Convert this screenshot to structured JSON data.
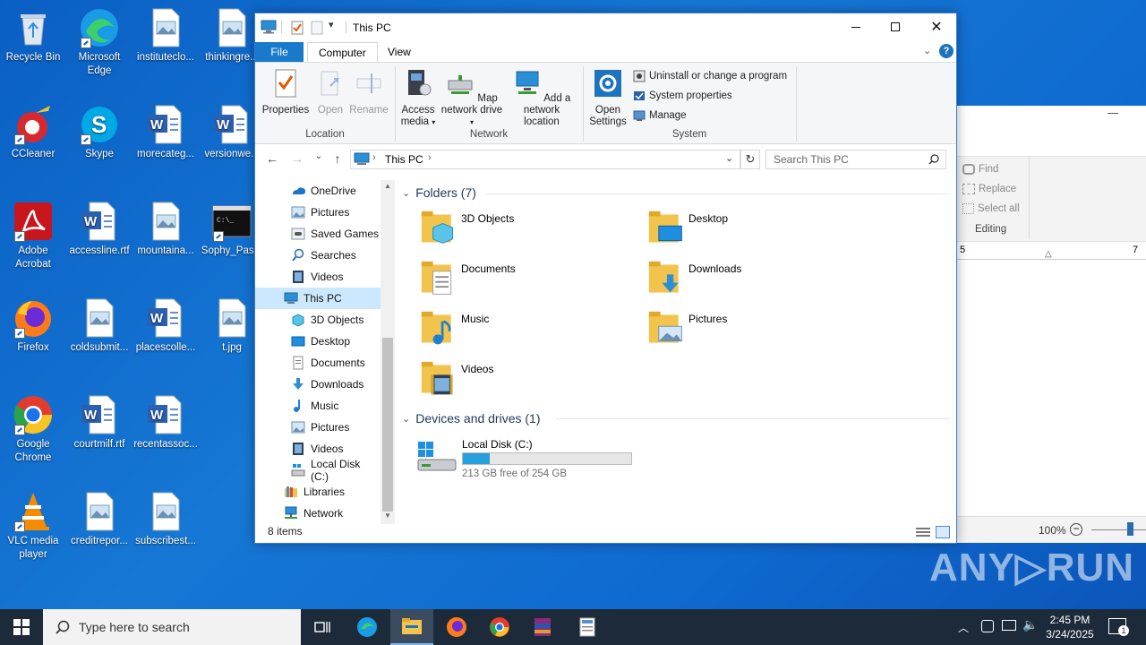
{
  "desktop": {
    "icons": [
      {
        "label": "Recycle Bin",
        "icon": "recycle-bin-icon"
      },
      {
        "label": "Microsoft Edge",
        "icon": "edge-icon"
      },
      {
        "label": "instituteclo...",
        "icon": "image-file-icon"
      },
      {
        "label": "thinkingre...",
        "icon": "image-file-icon"
      },
      {
        "label": "CCleaner",
        "icon": "ccleaner-icon"
      },
      {
        "label": "Skype",
        "icon": "skype-icon"
      },
      {
        "label": "morecateg...",
        "icon": "word-doc-icon"
      },
      {
        "label": "versionwe...",
        "icon": "word-doc-icon"
      },
      {
        "label": "Adobe Acrobat",
        "icon": "acrobat-icon"
      },
      {
        "label": "accessline.rtf",
        "icon": "word-doc-icon"
      },
      {
        "label": "mountaina...",
        "icon": "image-file-icon"
      },
      {
        "label": "Sophy_Pas...",
        "icon": "cmd-icon"
      },
      {
        "label": "Firefox",
        "icon": "firefox-icon"
      },
      {
        "label": "coldsubmit...",
        "icon": "image-file-icon"
      },
      {
        "label": "placescolle...",
        "icon": "word-doc-icon"
      },
      {
        "label": "t.jpg",
        "icon": "image-file-icon"
      },
      {
        "label": "Google Chrome",
        "icon": "chrome-icon"
      },
      {
        "label": "courtmilf.rtf",
        "icon": "word-doc-icon"
      },
      {
        "label": "recentassoc...",
        "icon": "word-doc-icon"
      },
      {
        "label": "VLC media player",
        "icon": "vlc-icon"
      },
      {
        "label": "creditrepor...",
        "icon": "image-file-icon"
      },
      {
        "label": "subscribest...",
        "icon": "image-file-icon"
      }
    ]
  },
  "word_bg": {
    "find": "Find",
    "replace": "Replace",
    "select_all": "Select all",
    "group": "Editing",
    "zoom": "100%",
    "ruler_left": "5",
    "ruler_right": "7"
  },
  "explorer": {
    "title": "This PC",
    "tabs": {
      "file": "File",
      "computer": "Computer",
      "view": "View"
    },
    "ribbon": {
      "properties": "Properties",
      "open": "Open",
      "rename": "Rename",
      "location_group": "Location",
      "access_media": "Access media",
      "map_network_drive": "Map network drive",
      "add_network_location": "Add a network location",
      "network_group": "Network",
      "open_settings": "Open Settings",
      "uninstall": "Uninstall or change a program",
      "system_properties": "System properties",
      "manage": "Manage",
      "system_group": "System"
    },
    "address": {
      "path": "This PC",
      "search_placeholder": "Search This PC"
    },
    "nav": [
      {
        "label": "OneDrive",
        "icon": "onedrive-icon"
      },
      {
        "label": "Pictures",
        "icon": "pictures-icon"
      },
      {
        "label": "Saved Games",
        "icon": "saved-games-icon"
      },
      {
        "label": "Searches",
        "icon": "search-icon"
      },
      {
        "label": "Videos",
        "icon": "videos-icon"
      },
      {
        "label": "This PC",
        "icon": "computer-icon"
      },
      {
        "label": "3D Objects",
        "icon": "3d-objects-icon"
      },
      {
        "label": "Desktop",
        "icon": "desktop-icon"
      },
      {
        "label": "Documents",
        "icon": "documents-icon"
      },
      {
        "label": "Downloads",
        "icon": "downloads-icon"
      },
      {
        "label": "Music",
        "icon": "music-icon"
      },
      {
        "label": "Pictures",
        "icon": "pictures-icon"
      },
      {
        "label": "Videos",
        "icon": "videos-icon"
      },
      {
        "label": "Local Disk (C:)",
        "icon": "drive-icon"
      },
      {
        "label": "Libraries",
        "icon": "libraries-icon"
      },
      {
        "label": "Network",
        "icon": "network-icon"
      }
    ],
    "folders_header": "Folders (7)",
    "folders": [
      {
        "label": "3D Objects",
        "icon": "3d-objects-folder-icon"
      },
      {
        "label": "Desktop",
        "icon": "desktop-folder-icon"
      },
      {
        "label": "Documents",
        "icon": "documents-folder-icon"
      },
      {
        "label": "Downloads",
        "icon": "downloads-folder-icon"
      },
      {
        "label": "Music",
        "icon": "music-folder-icon"
      },
      {
        "label": "Pictures",
        "icon": "pictures-folder-icon"
      },
      {
        "label": "Videos",
        "icon": "videos-folder-icon"
      }
    ],
    "devices_header": "Devices and drives (1)",
    "drive": {
      "label": "Local Disk (C:)",
      "free_text": "213 GB free of 254 GB",
      "used_fraction": 0.16
    },
    "status": "8 items"
  },
  "taskbar": {
    "search_placeholder": "Type here to search",
    "time": "2:45 PM",
    "date": "3/24/2025",
    "notification_count": "1"
  },
  "watermark": "ANY▷RUN",
  "colors": {
    "accent": "#1979ca",
    "selection": "#cce8ff",
    "drive_bar": "#26a0da",
    "header_text": "#1e395b"
  }
}
